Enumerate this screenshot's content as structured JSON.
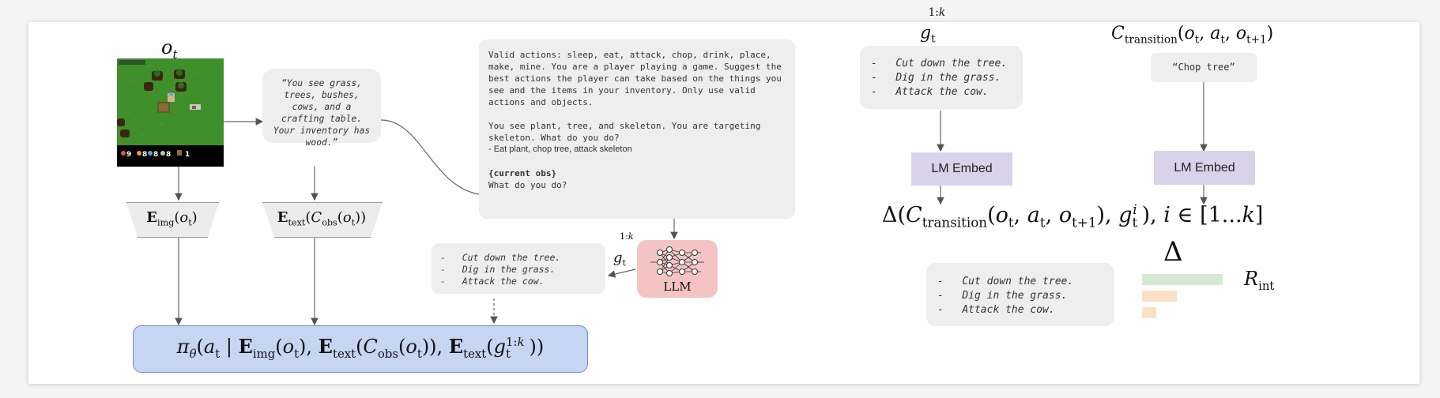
{
  "game_frame": {
    "obs_label": "o_t",
    "hud": [
      "9",
      "8",
      "8",
      "8",
      "1"
    ]
  },
  "caption": {
    "text": "“You see grass, trees, bushes, cows, and a crafting table. Your inventory has wood.”"
  },
  "encoders": {
    "img": "E_img(o_t)",
    "text": "E_text(C_obs(o_t))"
  },
  "prompt": {
    "intro": "Valid actions: sleep, eat, attack, chop, drink, place, make, mine. You are a player playing a game. Suggest the best actions the player can take based on the things you see and the items in your inventory. Only use valid actions and objects.",
    "example_obs": "You see plant, tree, and skeleton. You are targeting skeleton. What do you do?",
    "example_answer": "- Eat plant, chop tree, attack skeleton",
    "current_obs_tag": "{current obs}",
    "question": "What do you do?"
  },
  "llm": {
    "label": "LLM",
    "output_label": "g_t^{1:k}"
  },
  "goals": {
    "items": [
      "Cut down the tree.",
      "Dig in the grass.",
      "Attack the cow."
    ]
  },
  "policy": {
    "label": "π_θ(a_t | E_img(o_t), E_text(C_obs(o_t)), E_text(g_t^{1:k}))"
  },
  "right": {
    "goals_title": "g_t^{1:k}",
    "goals_items": [
      "Cut down the tree.",
      "Dig in the grass.",
      "Attack the cow."
    ],
    "transition_title": "C_transition(o_t, a_t, o_{t+1})",
    "transition_caption": "“Chop tree”",
    "embed_label": "LM Embed",
    "similarity": "Δ(C_transition(o_t, a_t, o_{t+1}), g_t^i), i ∈ [1...k]",
    "delta": "Δ",
    "reward_goals": [
      "Cut down the tree.",
      "Dig in the grass.",
      "Attack the cow."
    ],
    "reward_label": "R_int",
    "reward_bars": [
      {
        "value": 1.0,
        "color": "#d5ead2"
      },
      {
        "value": 0.43,
        "color": "#fbe0c8"
      },
      {
        "value": 0.18,
        "color": "#fbe0c8"
      }
    ]
  }
}
